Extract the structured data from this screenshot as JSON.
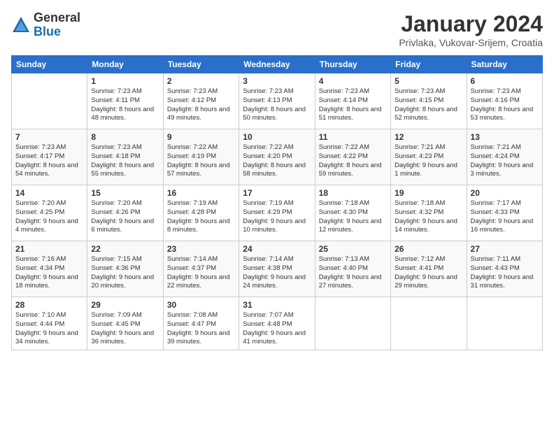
{
  "logo": {
    "general": "General",
    "blue": "Blue"
  },
  "title": "January 2024",
  "subtitle": "Privlaka, Vukovar-Srijem, Croatia",
  "days_header": [
    "Sunday",
    "Monday",
    "Tuesday",
    "Wednesday",
    "Thursday",
    "Friday",
    "Saturday"
  ],
  "weeks": [
    [
      {
        "num": "",
        "sunrise": "",
        "sunset": "",
        "daylight": ""
      },
      {
        "num": "1",
        "sunrise": "Sunrise: 7:23 AM",
        "sunset": "Sunset: 4:11 PM",
        "daylight": "Daylight: 8 hours and 48 minutes."
      },
      {
        "num": "2",
        "sunrise": "Sunrise: 7:23 AM",
        "sunset": "Sunset: 4:12 PM",
        "daylight": "Daylight: 8 hours and 49 minutes."
      },
      {
        "num": "3",
        "sunrise": "Sunrise: 7:23 AM",
        "sunset": "Sunset: 4:13 PM",
        "daylight": "Daylight: 8 hours and 50 minutes."
      },
      {
        "num": "4",
        "sunrise": "Sunrise: 7:23 AM",
        "sunset": "Sunset: 4:14 PM",
        "daylight": "Daylight: 8 hours and 51 minutes."
      },
      {
        "num": "5",
        "sunrise": "Sunrise: 7:23 AM",
        "sunset": "Sunset: 4:15 PM",
        "daylight": "Daylight: 8 hours and 52 minutes."
      },
      {
        "num": "6",
        "sunrise": "Sunrise: 7:23 AM",
        "sunset": "Sunset: 4:16 PM",
        "daylight": "Daylight: 8 hours and 53 minutes."
      }
    ],
    [
      {
        "num": "7",
        "sunrise": "Sunrise: 7:23 AM",
        "sunset": "Sunset: 4:17 PM",
        "daylight": "Daylight: 8 hours and 54 minutes."
      },
      {
        "num": "8",
        "sunrise": "Sunrise: 7:23 AM",
        "sunset": "Sunset: 4:18 PM",
        "daylight": "Daylight: 8 hours and 55 minutes."
      },
      {
        "num": "9",
        "sunrise": "Sunrise: 7:22 AM",
        "sunset": "Sunset: 4:19 PM",
        "daylight": "Daylight: 8 hours and 57 minutes."
      },
      {
        "num": "10",
        "sunrise": "Sunrise: 7:22 AM",
        "sunset": "Sunset: 4:20 PM",
        "daylight": "Daylight: 8 hours and 58 minutes."
      },
      {
        "num": "11",
        "sunrise": "Sunrise: 7:22 AM",
        "sunset": "Sunset: 4:22 PM",
        "daylight": "Daylight: 8 hours and 59 minutes."
      },
      {
        "num": "12",
        "sunrise": "Sunrise: 7:21 AM",
        "sunset": "Sunset: 4:23 PM",
        "daylight": "Daylight: 9 hours and 1 minute."
      },
      {
        "num": "13",
        "sunrise": "Sunrise: 7:21 AM",
        "sunset": "Sunset: 4:24 PM",
        "daylight": "Daylight: 9 hours and 3 minutes."
      }
    ],
    [
      {
        "num": "14",
        "sunrise": "Sunrise: 7:20 AM",
        "sunset": "Sunset: 4:25 PM",
        "daylight": "Daylight: 9 hours and 4 minutes."
      },
      {
        "num": "15",
        "sunrise": "Sunrise: 7:20 AM",
        "sunset": "Sunset: 4:26 PM",
        "daylight": "Daylight: 9 hours and 6 minutes."
      },
      {
        "num": "16",
        "sunrise": "Sunrise: 7:19 AM",
        "sunset": "Sunset: 4:28 PM",
        "daylight": "Daylight: 9 hours and 8 minutes."
      },
      {
        "num": "17",
        "sunrise": "Sunrise: 7:19 AM",
        "sunset": "Sunset: 4:29 PM",
        "daylight": "Daylight: 9 hours and 10 minutes."
      },
      {
        "num": "18",
        "sunrise": "Sunrise: 7:18 AM",
        "sunset": "Sunset: 4:30 PM",
        "daylight": "Daylight: 9 hours and 12 minutes."
      },
      {
        "num": "19",
        "sunrise": "Sunrise: 7:18 AM",
        "sunset": "Sunset: 4:32 PM",
        "daylight": "Daylight: 9 hours and 14 minutes."
      },
      {
        "num": "20",
        "sunrise": "Sunrise: 7:17 AM",
        "sunset": "Sunset: 4:33 PM",
        "daylight": "Daylight: 9 hours and 16 minutes."
      }
    ],
    [
      {
        "num": "21",
        "sunrise": "Sunrise: 7:16 AM",
        "sunset": "Sunset: 4:34 PM",
        "daylight": "Daylight: 9 hours and 18 minutes."
      },
      {
        "num": "22",
        "sunrise": "Sunrise: 7:15 AM",
        "sunset": "Sunset: 4:36 PM",
        "daylight": "Daylight: 9 hours and 20 minutes."
      },
      {
        "num": "23",
        "sunrise": "Sunrise: 7:14 AM",
        "sunset": "Sunset: 4:37 PM",
        "daylight": "Daylight: 9 hours and 22 minutes."
      },
      {
        "num": "24",
        "sunrise": "Sunrise: 7:14 AM",
        "sunset": "Sunset: 4:38 PM",
        "daylight": "Daylight: 9 hours and 24 minutes."
      },
      {
        "num": "25",
        "sunrise": "Sunrise: 7:13 AM",
        "sunset": "Sunset: 4:40 PM",
        "daylight": "Daylight: 9 hours and 27 minutes."
      },
      {
        "num": "26",
        "sunrise": "Sunrise: 7:12 AM",
        "sunset": "Sunset: 4:41 PM",
        "daylight": "Daylight: 9 hours and 29 minutes."
      },
      {
        "num": "27",
        "sunrise": "Sunrise: 7:11 AM",
        "sunset": "Sunset: 4:43 PM",
        "daylight": "Daylight: 9 hours and 31 minutes."
      }
    ],
    [
      {
        "num": "28",
        "sunrise": "Sunrise: 7:10 AM",
        "sunset": "Sunset: 4:44 PM",
        "daylight": "Daylight: 9 hours and 34 minutes."
      },
      {
        "num": "29",
        "sunrise": "Sunrise: 7:09 AM",
        "sunset": "Sunset: 4:45 PM",
        "daylight": "Daylight: 9 hours and 36 minutes."
      },
      {
        "num": "30",
        "sunrise": "Sunrise: 7:08 AM",
        "sunset": "Sunset: 4:47 PM",
        "daylight": "Daylight: 9 hours and 39 minutes."
      },
      {
        "num": "31",
        "sunrise": "Sunrise: 7:07 AM",
        "sunset": "Sunset: 4:48 PM",
        "daylight": "Daylight: 9 hours and 41 minutes."
      },
      {
        "num": "",
        "sunrise": "",
        "sunset": "",
        "daylight": ""
      },
      {
        "num": "",
        "sunrise": "",
        "sunset": "",
        "daylight": ""
      },
      {
        "num": "",
        "sunrise": "",
        "sunset": "",
        "daylight": ""
      }
    ]
  ]
}
